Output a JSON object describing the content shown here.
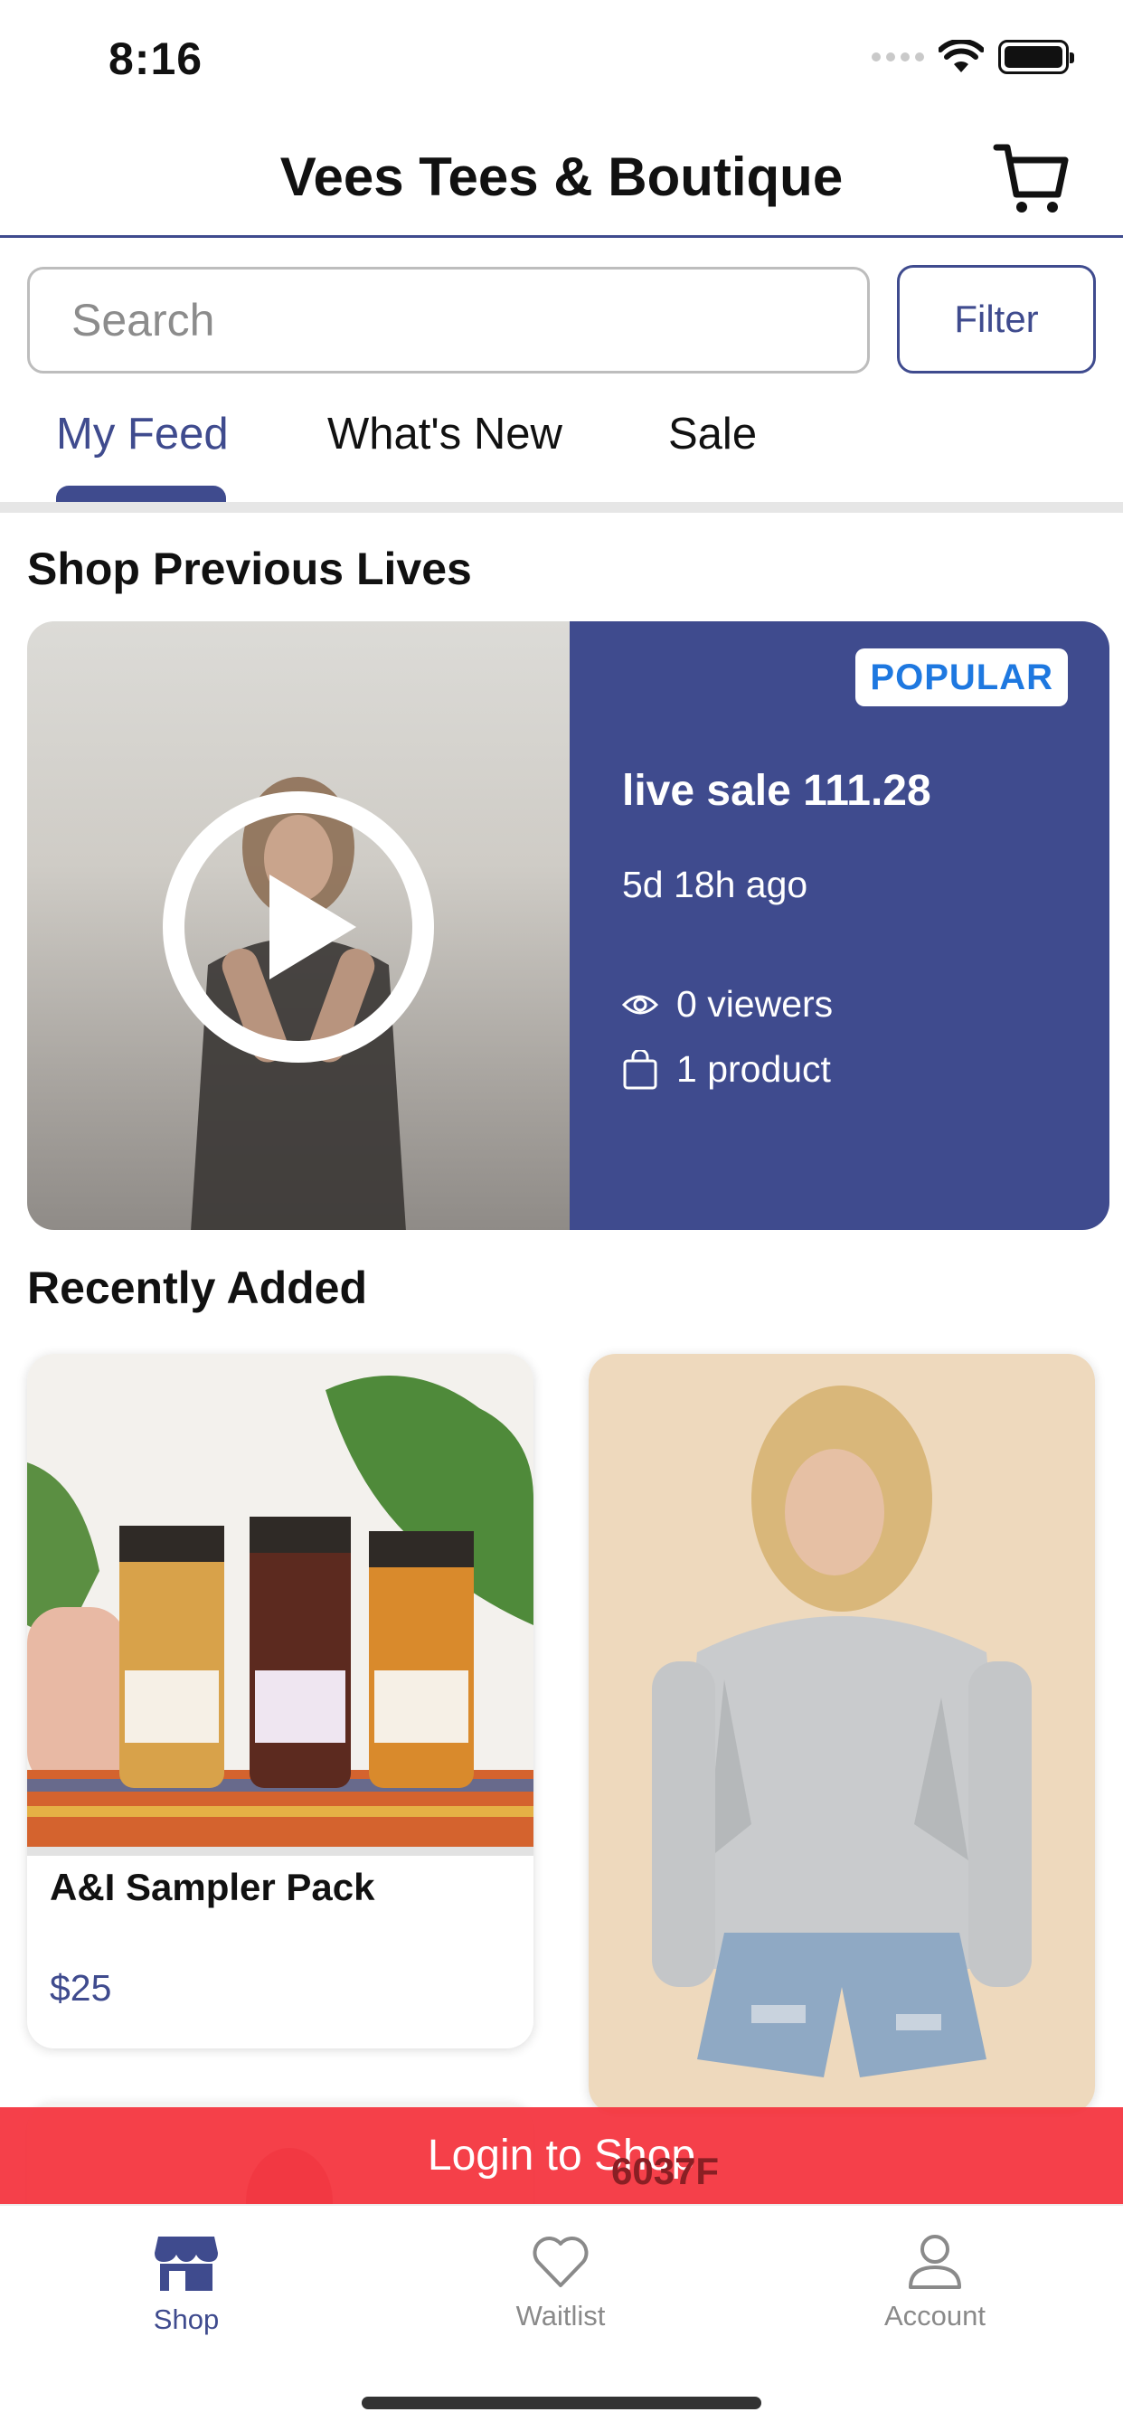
{
  "status_bar": {
    "time": "8:16"
  },
  "header": {
    "title": "Vees Tees & Boutique",
    "cart_icon": "cart-icon"
  },
  "search": {
    "placeholder": "Search",
    "filter_label": "Filter"
  },
  "tabs": [
    {
      "label": "My Feed",
      "active": true
    },
    {
      "label": "What's New",
      "active": false
    },
    {
      "label": "Sale",
      "active": false
    }
  ],
  "previous_lives": {
    "section_title": "Shop Previous Lives",
    "card": {
      "badge": "POPULAR",
      "title": "live sale 111.28",
      "ago": "5d 18h ago",
      "viewers": "0 viewers",
      "products": "1 product"
    }
  },
  "recently_added": {
    "section_title": "Recently Added",
    "products": [
      {
        "name": "A&I Sampler Pack",
        "price": "$25"
      },
      {
        "name": "",
        "price": ""
      }
    ],
    "partial_third_label": "6037F"
  },
  "login_banner": {
    "label": "Login to Shop"
  },
  "tab_bar": {
    "items": [
      {
        "label": "Shop",
        "icon": "store-icon",
        "active": true
      },
      {
        "label": "Waitlist",
        "icon": "heart-icon",
        "active": false
      },
      {
        "label": "Account",
        "icon": "person-icon",
        "active": false
      }
    ]
  },
  "colors": {
    "brand": "#3f4b8e",
    "badge_text": "#1e78e0",
    "login_banner": "#f4323c",
    "inactive": "#8a8a8a"
  }
}
